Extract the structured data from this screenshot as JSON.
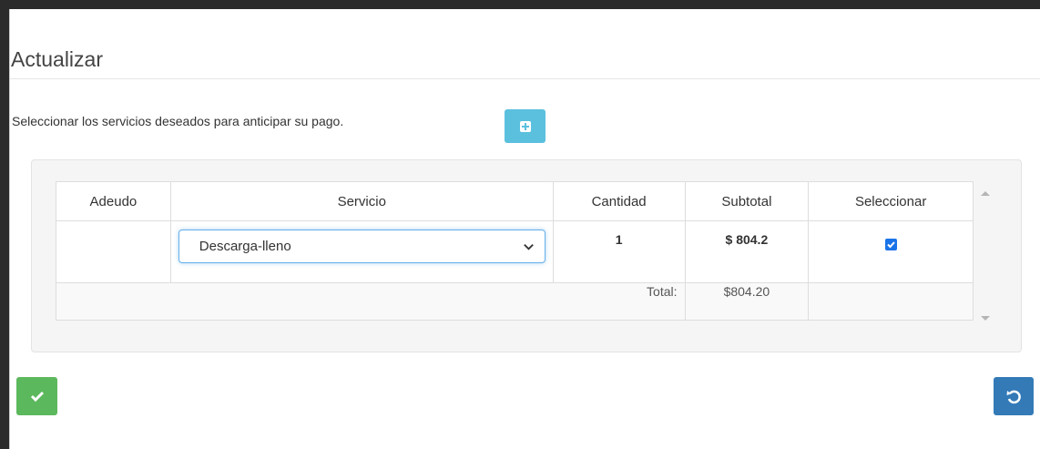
{
  "modal": {
    "title": "Actualizar",
    "instructions": "Seleccionar los servicios deseados para anticipar su pago."
  },
  "table": {
    "headers": [
      "Adeudo",
      "Servicio",
      "Cantidad",
      "Subtotal",
      "Seleccionar"
    ],
    "rows": [
      {
        "adeudo": "",
        "servicio": "Descarga-lleno",
        "cantidad": "1",
        "subtotal": "$ 804.2",
        "seleccionar": true
      }
    ],
    "total_label": "Total:",
    "total_value": "$804.20"
  },
  "buttons": {
    "add": "plus-square-icon",
    "confirm": "check-icon",
    "reset": "undo-icon"
  },
  "colors": {
    "info": "#5bc0de",
    "success": "#5cb85c",
    "primary": "#337ab7"
  }
}
